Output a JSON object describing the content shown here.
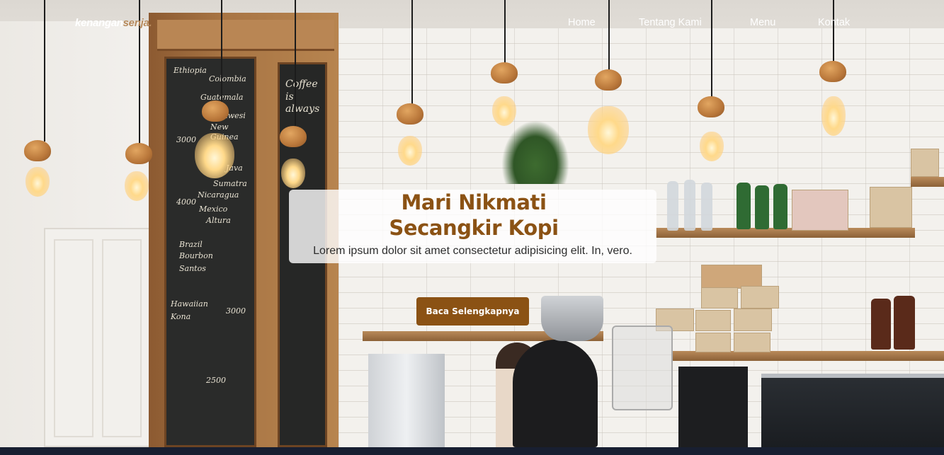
{
  "brand": {
    "part1": "kenangan",
    "part2": "senja",
    "dot": "."
  },
  "nav": {
    "items": [
      {
        "label": "Home"
      },
      {
        "label": "Tentang Kami"
      },
      {
        "label": "Menu"
      },
      {
        "label": "Kontak"
      }
    ]
  },
  "hero": {
    "title_line1": "Mari Nikmati",
    "title_line2": "Secangkir Kopi",
    "subtitle": "Lorem ipsum dolor sit amet consectetur adipisicing elit. In, vero.",
    "cta_label": "Baca Selengkapnya"
  },
  "chalkboard": {
    "lines": [
      "Ethiopia",
      "Colombia",
      "Guatemala",
      "Sulawesi",
      "New Guinea",
      "3000",
      "Java",
      "Sumatra",
      "Nicaragua",
      "4000",
      "Mexico",
      "Altura",
      "Brazil",
      "Bourbon",
      "Santos",
      "Hawaiian",
      "Kona",
      "3000",
      "2500"
    ],
    "side": "Coffee is always"
  },
  "colors": {
    "accent": "#8b5214",
    "logo_accent": "#b6895b",
    "footer": "#181f31"
  }
}
